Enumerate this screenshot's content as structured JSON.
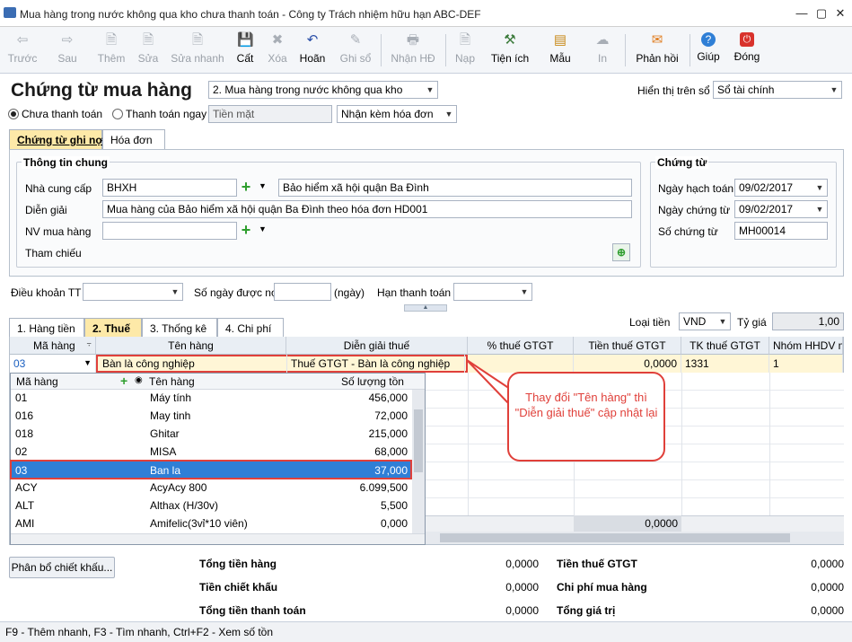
{
  "window": {
    "title": "Mua hàng trong nước không qua kho chưa thanh toán - Công ty Trách nhiệm hữu hạn ABC-DEF"
  },
  "toolbar": {
    "items": [
      {
        "label": "Trước",
        "icon": "arrow-left-icon"
      },
      {
        "label": "Sau",
        "icon": "arrow-right-icon"
      },
      {
        "label": "Thêm",
        "icon": "new-doc-icon"
      },
      {
        "label": "Sửa",
        "icon": "edit-icon"
      },
      {
        "label": "Sửa nhanh",
        "icon": "quick-edit-icon"
      },
      {
        "label": "Cất",
        "icon": "save-icon"
      },
      {
        "label": "Xóa",
        "icon": "delete-icon"
      },
      {
        "label": "Hoãn",
        "icon": "undo-icon"
      },
      {
        "label": "Ghi sổ",
        "icon": "pen-icon"
      },
      {
        "label": "Nhận HĐ",
        "icon": "receive-invoice-icon"
      },
      {
        "label": "Nạp",
        "icon": "reload-icon"
      },
      {
        "label": "Tiện ích",
        "icon": "tools-icon"
      },
      {
        "label": "Mẫu",
        "icon": "template-icon"
      },
      {
        "label": "In",
        "icon": "print-icon"
      },
      {
        "label": "Phản hồi",
        "icon": "mail-icon"
      },
      {
        "label": "Giúp",
        "icon": "help-icon"
      },
      {
        "label": "Đóng",
        "icon": "close-icon"
      }
    ]
  },
  "header": {
    "title": "Chứng từ mua hàng",
    "voucher_type": "2. Mua hàng trong nước không qua kho",
    "show_on_book_label": "Hiển thị trên sổ",
    "show_on_book_value": "Sổ tài chính",
    "radio_unpaid": "Chưa thanh toán",
    "radio_paid": "Thanh toán ngay",
    "payment_method": "Tiền mặt",
    "invoice_option": "Nhận kèm hóa đơn"
  },
  "tabs_top": [
    "Chứng từ ghi nợ",
    "Hóa đơn"
  ],
  "general": {
    "title": "Thông tin chung",
    "supplier_label": "Nhà cung cấp",
    "supplier_code": "BHXH",
    "supplier_name": "Bảo hiểm xã hội quận Ba Đình",
    "desc_label": "Diễn giải",
    "desc_value": "Mua hàng của Bảo hiểm xã hội quận Ba Đình theo hóa đơn HD001",
    "buyer_label": "NV mua hàng",
    "buyer_value": "",
    "ref_label": "Tham chiếu"
  },
  "voucher": {
    "title": "Chứng từ",
    "posting_date_label": "Ngày hạch toán",
    "posting_date": "09/02/2017",
    "voucher_date_label": "Ngày chứng từ",
    "voucher_date": "09/02/2017",
    "voucher_no_label": "Số chứng từ",
    "voucher_no": "MH00014"
  },
  "terms": {
    "terms_label": "Điều khoản TT",
    "days_label": "Số ngày được nợ",
    "days_unit": "(ngày)",
    "due_label": "Hạn thanh toán"
  },
  "tabs_detail": [
    "1. Hàng tiền",
    "2. Thuế",
    "3. Thống kê",
    "4. Chi phí"
  ],
  "currency": {
    "label": "Loại tiền",
    "value": "VND",
    "rate_label": "Tỷ giá",
    "rate_value": "1,00"
  },
  "grid": {
    "headers": [
      "Mã hàng",
      "Tên hàng",
      "Diễn giải thuế",
      "% thuế GTGT",
      "Tiền thuế GTGT",
      "TK thuế GTGT",
      "Nhóm HHDV mu"
    ],
    "row": {
      "code": "03",
      "name": "Bàn là công nghiệp",
      "tax_desc": "Thuế GTGT - Bàn là công nghiệp",
      "tax_pct": "",
      "tax_amount": "0,0000",
      "tax_account": "1331",
      "group": "1"
    },
    "footer_total": "0,0000"
  },
  "dropdown": {
    "headers": [
      "Mã hàng",
      "Tên hàng",
      "Số lượng tồn"
    ],
    "rows": [
      {
        "code": "01",
        "name": "Máy tính",
        "qty": "456,000"
      },
      {
        "code": "016",
        "name": "May tinh",
        "qty": "72,000"
      },
      {
        "code": "018",
        "name": "Ghitar",
        "qty": "215,000"
      },
      {
        "code": "02",
        "name": "MISA",
        "qty": "68,000"
      },
      {
        "code": "03",
        "name": "Ban la",
        "qty": "37,000"
      },
      {
        "code": "ACY",
        "name": "AcyAcy 800",
        "qty": "6.099,500"
      },
      {
        "code": "ALT",
        "name": "Althax (H/30v)",
        "qty": "5,500"
      },
      {
        "code": "AMI",
        "name": "Amifelic(3vỉ*10 viên)",
        "qty": "0,000"
      }
    ]
  },
  "callout": "Thay đổi \"Tên hàng\" thì \"Diễn giải thuế\" cập nhật lại",
  "totals": {
    "alloc_button": "Phân bổ chiết khấu...",
    "total_goods_label": "Tổng tiền hàng",
    "total_goods": "0,0000",
    "discount_label": "Tiền chiết khấu",
    "discount": "0,0000",
    "payment_label": "Tổng tiền thanh toán",
    "payment": "0,0000",
    "vat_label": "Tiền thuế GTGT",
    "vat": "0,0000",
    "purchase_cost_label": "Chi phí mua hàng",
    "purchase_cost": "0,0000",
    "value_label": "Tổng giá trị",
    "value": "0,0000"
  },
  "status": "F9 - Thêm nhanh, F3 - Tìm nhanh, Ctrl+F2 - Xem số tồn",
  "colors": {
    "accent": "#2f7fd6",
    "highlight": "#e0403a",
    "active_tab": "#fde9a8"
  }
}
